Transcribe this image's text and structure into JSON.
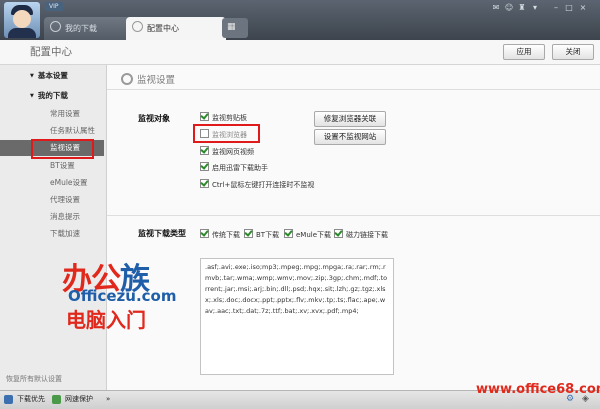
{
  "titlebar": {
    "vip_badge": "VIP",
    "tabs": [
      {
        "label": "我的下载"
      },
      {
        "label": "配置中心"
      }
    ],
    "grid_glyph": "▦"
  },
  "header": {
    "title": "配置中心",
    "apply_label": "应用",
    "close_label": "关闭"
  },
  "sidebar": {
    "groups": [
      {
        "label": "基本设置"
      },
      {
        "label": "我的下载"
      }
    ],
    "items": [
      {
        "label": "常用设置"
      },
      {
        "label": "任务默认属性"
      },
      {
        "label": "监视设置"
      },
      {
        "label": "BT设置"
      },
      {
        "label": "eMule设置"
      },
      {
        "label": "代理设置"
      },
      {
        "label": "消息提示"
      },
      {
        "label": "下载加速"
      }
    ],
    "active_index": 2,
    "restore_label": "恢复所有默认设置"
  },
  "main": {
    "section_title": "监视设置",
    "monitor_label": "监视对象",
    "monitor_options": [
      {
        "label": "监视剪贴板",
        "checked": true
      },
      {
        "label": "监视浏览器",
        "checked": false
      },
      {
        "label": "监视网页视频",
        "checked": true
      },
      {
        "label": "启用迅雷下载助手",
        "checked": true
      },
      {
        "label": "Ctrl+鼠标左键打开连接时不监视",
        "checked": true
      }
    ],
    "repair_button": "修复浏览器关联",
    "no_monitor_site_button": "设置不监视网站",
    "type_label": "监视下载类型",
    "type_options": [
      {
        "label": "传统下载",
        "checked": true
      },
      {
        "label": "BT下载",
        "checked": true
      },
      {
        "label": "eMule下载",
        "checked": true
      },
      {
        "label": "磁力链接下载",
        "checked": true
      }
    ],
    "extensions": ".asf;.avi;.exe;.iso;mp3;.mpeg;.mpg;.mpga;.ra;.rar;.rm;.rmvb;.tar;.wma;.wmp;.wmv;.mov;.zip;.3gp;.chm;.mdf;.torrent;.jar;.msi;.arj;.bin;.dll;.psd;.hqx;.sit;.lzh;.gz;.tgz;.xlsx;.xls;.doc;.docx;.ppt;.pptx;.flv;.mkv;.tp;.ts;.flac;.ape;.wav;.aac;.txt;.dat;.7z;.ttf;.bat;.xv;.xvx;.pdf;.mp4;"
  },
  "statusbar": {
    "items": [
      {
        "label": "下载优先"
      },
      {
        "label": "网速保护"
      }
    ]
  },
  "watermark": {
    "brand_part1": "办公",
    "brand_part2": "族",
    "domain": "Officezu.com",
    "slogan": "电脑入门",
    "site": "www.office68.com"
  },
  "colors": {
    "highlight_red": "#e01a1a",
    "check_green": "#2c8a2c",
    "active_item_bg": "#6a6a6a"
  }
}
